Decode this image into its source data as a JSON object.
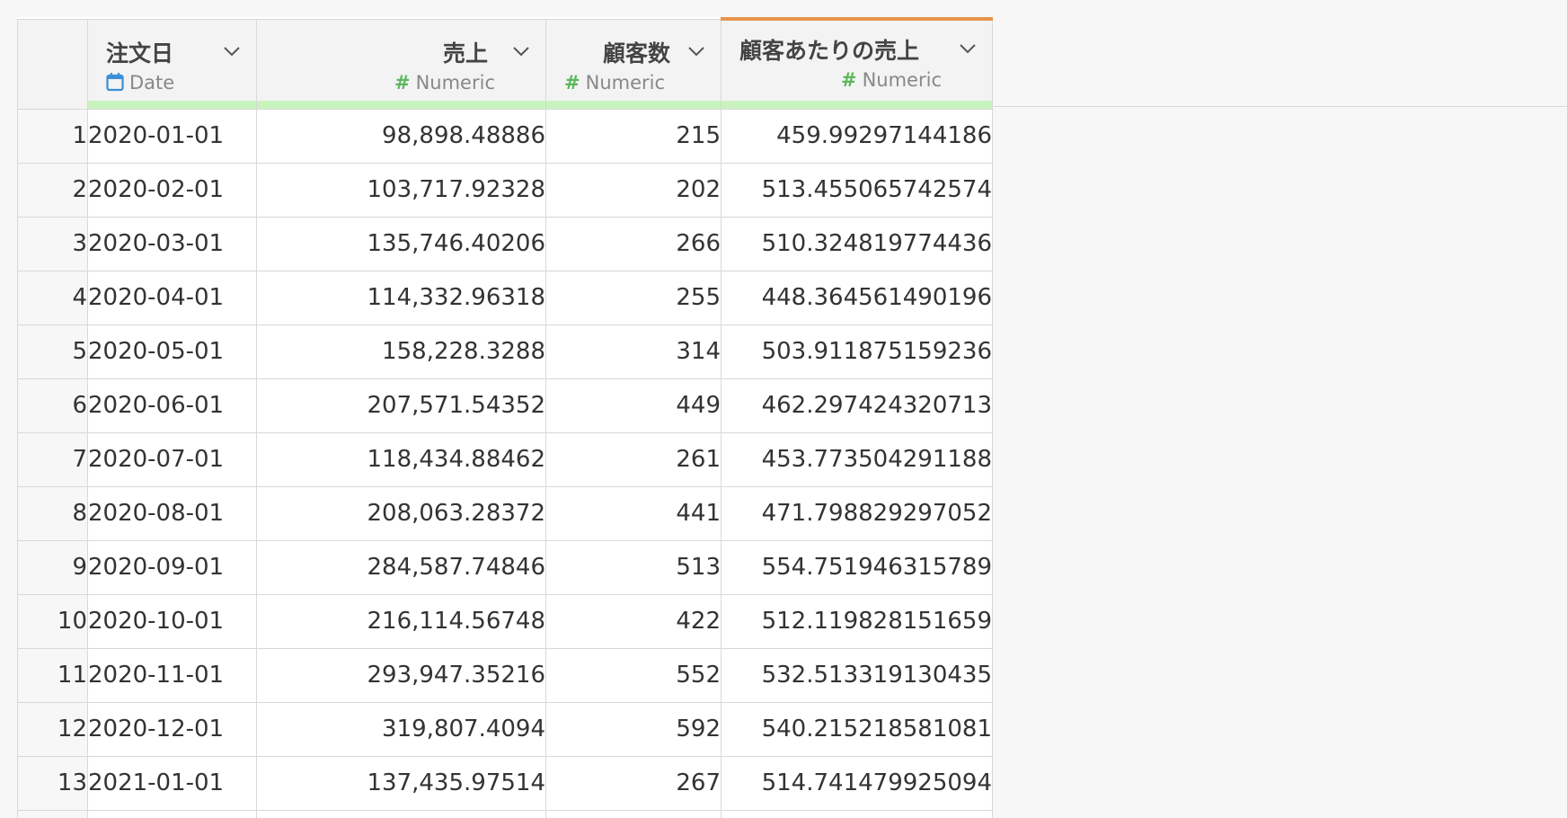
{
  "columns": [
    {
      "title": "注文日",
      "type": "Date",
      "type_icon": "calendar-icon"
    },
    {
      "title": "売上",
      "type": "Numeric",
      "type_icon": "hash-icon"
    },
    {
      "title": "顧客数",
      "type": "Numeric",
      "type_icon": "hash-icon"
    },
    {
      "title": "顧客あたりの売上",
      "type": "Numeric",
      "type_icon": "hash-icon"
    }
  ],
  "selected_column": "顧客あたりの売上",
  "colors": {
    "selected_accent": "#e8944d",
    "header_status_bar": "#c9f3bf",
    "numeric_icon": "#5cb85c",
    "date_icon": "#3a8fd6"
  },
  "rows": [
    {
      "n": "1",
      "date": "2020-01-01",
      "sales": "98,898.48886",
      "customers": "215",
      "per_customer": "459.99297144186"
    },
    {
      "n": "2",
      "date": "2020-02-01",
      "sales": "103,717.92328",
      "customers": "202",
      "per_customer": "513.455065742574"
    },
    {
      "n": "3",
      "date": "2020-03-01",
      "sales": "135,746.40206",
      "customers": "266",
      "per_customer": "510.324819774436"
    },
    {
      "n": "4",
      "date": "2020-04-01",
      "sales": "114,332.96318",
      "customers": "255",
      "per_customer": "448.364561490196"
    },
    {
      "n": "5",
      "date": "2020-05-01",
      "sales": "158,228.3288",
      "customers": "314",
      "per_customer": "503.911875159236"
    },
    {
      "n": "6",
      "date": "2020-06-01",
      "sales": "207,571.54352",
      "customers": "449",
      "per_customer": "462.297424320713"
    },
    {
      "n": "7",
      "date": "2020-07-01",
      "sales": "118,434.88462",
      "customers": "261",
      "per_customer": "453.773504291188"
    },
    {
      "n": "8",
      "date": "2020-08-01",
      "sales": "208,063.28372",
      "customers": "441",
      "per_customer": "471.798829297052"
    },
    {
      "n": "9",
      "date": "2020-09-01",
      "sales": "284,587.74846",
      "customers": "513",
      "per_customer": "554.751946315789"
    },
    {
      "n": "10",
      "date": "2020-10-01",
      "sales": "216,114.56748",
      "customers": "422",
      "per_customer": "512.119828151659"
    },
    {
      "n": "11",
      "date": "2020-11-01",
      "sales": "293,947.35216",
      "customers": "552",
      "per_customer": "532.513319130435"
    },
    {
      "n": "12",
      "date": "2020-12-01",
      "sales": "319,807.4094",
      "customers": "592",
      "per_customer": "540.215218581081"
    },
    {
      "n": "13",
      "date": "2021-01-01",
      "sales": "137,435.97514",
      "customers": "267",
      "per_customer": "514.741479925094"
    }
  ]
}
